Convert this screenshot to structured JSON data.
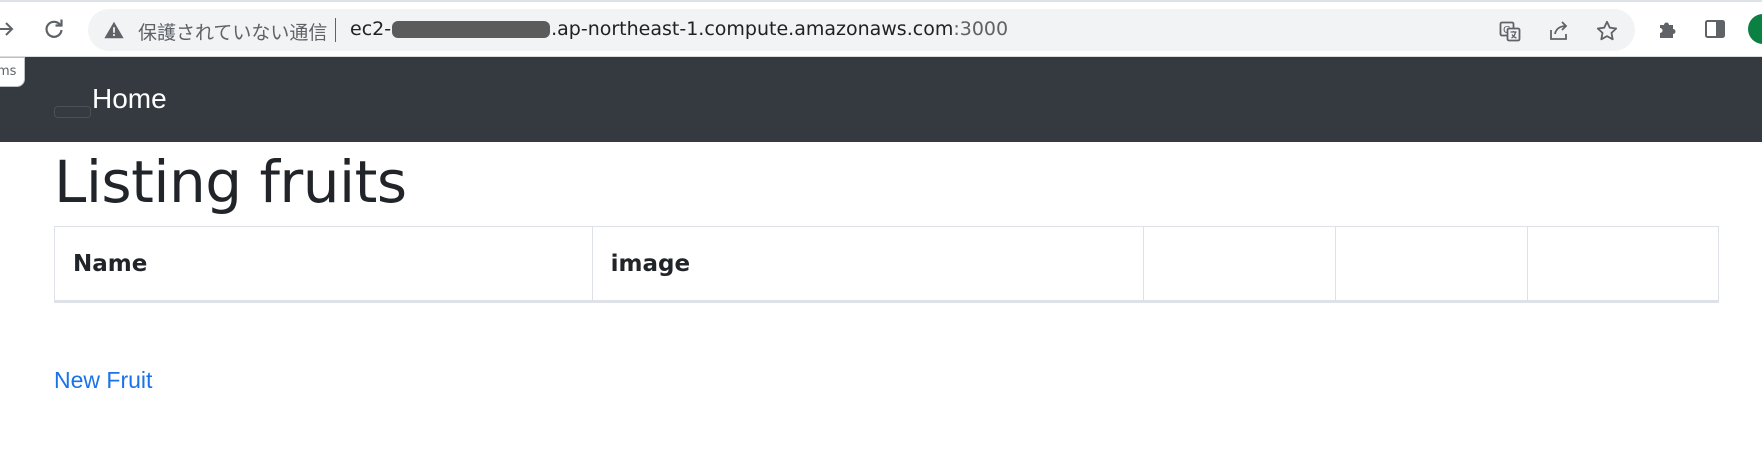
{
  "browser": {
    "address_bar": {
      "security_text": "保護されていない通信",
      "url_prefix": "ec2-",
      "url_host_suffix": ".ap-northeast-1.compute.amazonaws.com",
      "url_port": ":3000"
    },
    "side_stub_text": "ms"
  },
  "navbar": {
    "brand": "Home",
    "background_color": "#343a40"
  },
  "main": {
    "title": "Listing fruits",
    "table": {
      "headers": [
        "Name",
        "image",
        "",
        "",
        ""
      ],
      "rows": []
    },
    "new_link": "New Fruit"
  },
  "colors": {
    "link": "#1a73e8",
    "profile": "#0b8043"
  }
}
